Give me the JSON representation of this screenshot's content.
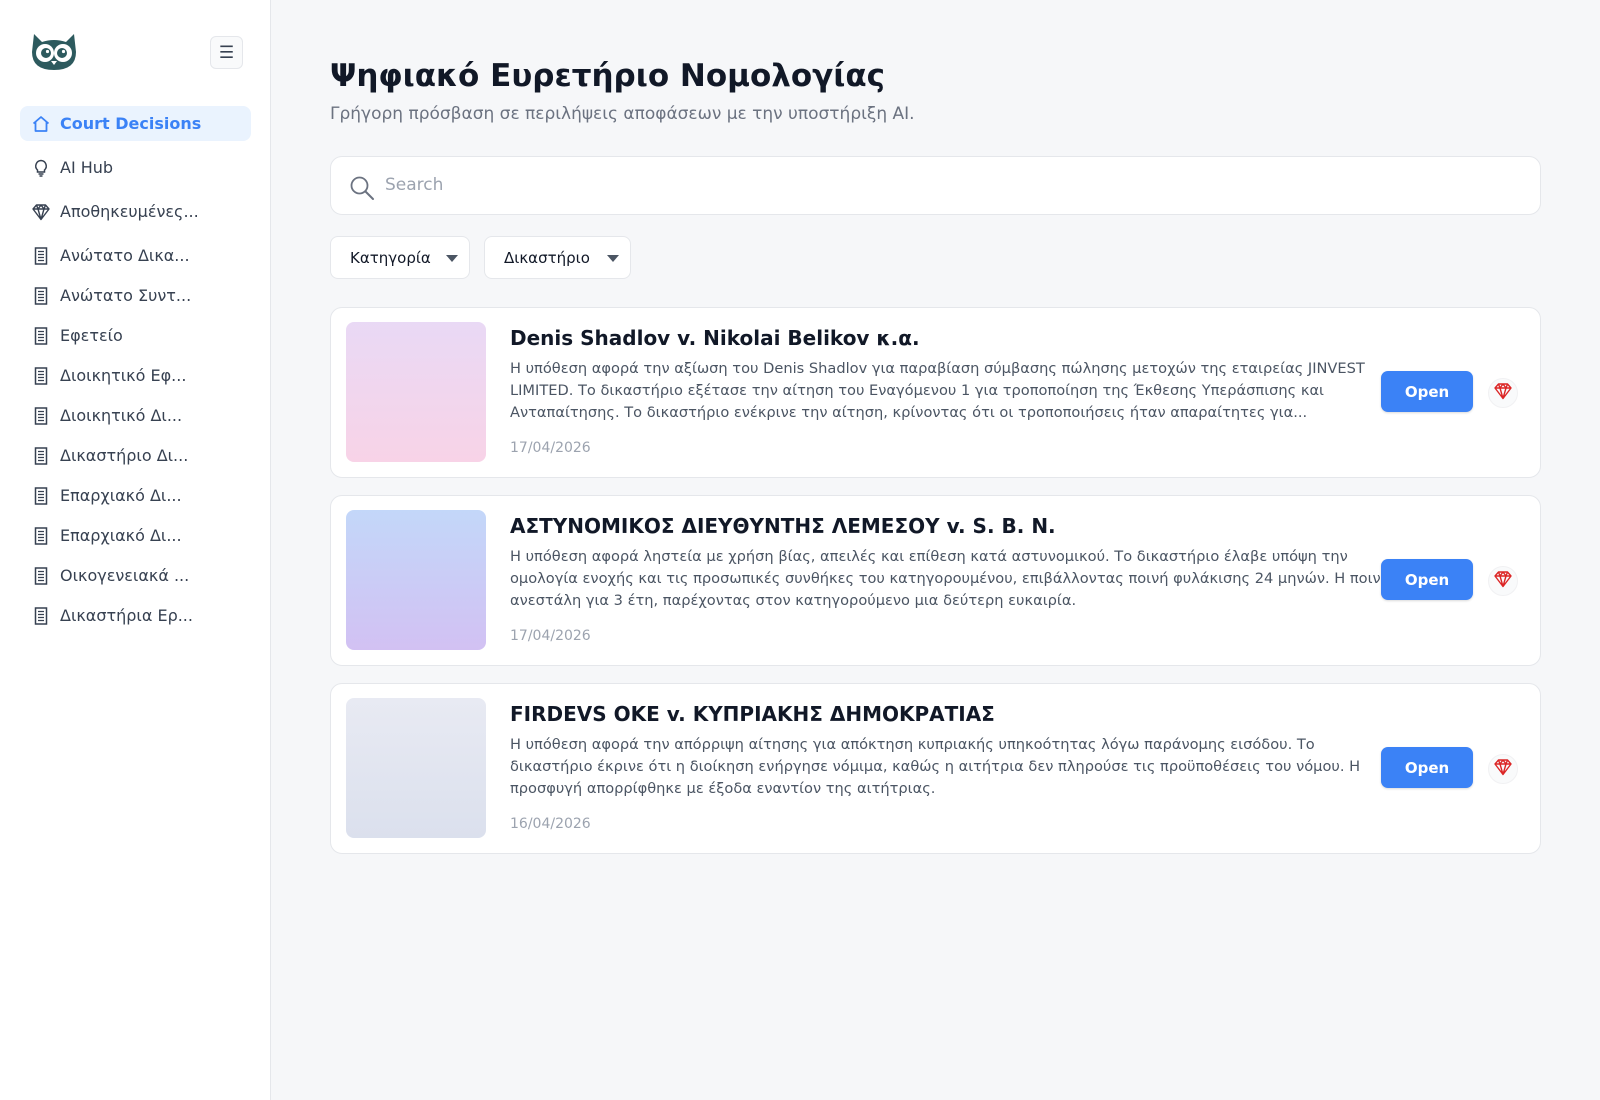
{
  "app": {
    "logo": "owl-logo",
    "menu_toggle": "☰"
  },
  "sidebar": {
    "items": [
      {
        "label": "Court Decisions",
        "icon": "home-icon",
        "active": true
      },
      {
        "label": "AI Hub",
        "icon": "lightbulb-icon"
      },
      {
        "label": "Αποθηκευμένες...",
        "icon": "diamond-icon"
      },
      {
        "label": "Ανώτατο Δικα...",
        "icon": "building-icon"
      },
      {
        "label": "Ανώτατο Συντ...",
        "icon": "building-icon"
      },
      {
        "label": "Εφετείο",
        "icon": "building-icon"
      },
      {
        "label": "Διοικητικό Εφ...",
        "icon": "building-icon"
      },
      {
        "label": "Διοικητικό Δι...",
        "icon": "building-icon"
      },
      {
        "label": "Δικαστήριο Δι...",
        "icon": "building-icon"
      },
      {
        "label": "Επαρχιακό Δι...",
        "icon": "building-icon"
      },
      {
        "label": "Επαρχιακό Δι...",
        "icon": "building-icon"
      },
      {
        "label": "Οικογενειακά ...",
        "icon": "building-icon"
      },
      {
        "label": "Δικαστήρια Ερ...",
        "icon": "building-icon"
      }
    ]
  },
  "main": {
    "title": "Ψηφιακό Ευρετήριο Νομολογίας",
    "subtitle": "Γρήγορη πρόσβαση σε περιλήψεις αποφάσεων με την υποστήριξη AI.",
    "search": {
      "placeholder": "Search",
      "value": ""
    },
    "filters": {
      "category": "Κατηγορία",
      "court": "Δικαστήριο"
    },
    "open_label": "Open",
    "cases": [
      {
        "title": "Denis Shadlov v. Nikolai Belikov κ.α.",
        "description": "Η υπόθεση αφορά την αξίωση του Denis Shadlov για παραβίαση σύμβασης πώλησης μετοχών της εταιρείας JINVEST LIMITED. Το δικαστήριο εξέτασε την αίτηση του Εναγόμενου 1 για τροποποίηση της Έκθεσης Υπεράσπισης και Ανταπαίτησης. Το δικαστήριο ενέκρινε την αίτηση, κρίνοντας ότι οι τροποποιήσεις ήταν απαραίτητες για...",
        "date": "17/04/2026",
        "thumb_colors": [
          "#e9d9f5",
          "#f8d3e7"
        ]
      },
      {
        "title": "ΑΣΤΥΝΟΜΙΚΟΣ ΔΙΕΥΘΥΝΤΗΣ ΛΕΜΕΣΟΥ v. S. B. N.",
        "description": "Η υπόθεση αφορά ληστεία με χρήση βίας, απειλές και επίθεση κατά αστυνομικού. Το δικαστήριο έλαβε υπόψη την ομολογία ενοχής και τις προσωπικές συνθήκες του κατηγορουμένου, επιβάλλοντας ποινή φυλάκισης 24 μηνών. Η ποινή ανεστάλη για 3 έτη, παρέχοντας στον κατηγορούμενο μια δεύτερη ευκαιρία.",
        "date": "17/04/2026",
        "thumb_colors": [
          "#c3d7f9",
          "#d2c1f3"
        ]
      },
      {
        "title": "FIRDEVS OKE v. ΚΥΠΡΙΑΚΗΣ ΔΗΜΟΚΡΑΤΙΑΣ",
        "description": "Η υπόθεση αφορά την απόρριψη αίτησης για απόκτηση κυπριακής υπηκοότητας λόγω παράνομης εισόδου. Το δικαστήριο έκρινε ότι η διοίκηση ενήργησε νόμιμα, καθώς η αιτήτρια δεν πληρούσε τις προϋποθέσεις του νόμου. Η προσφυγή απορρίφθηκε με έξοδα εναντίον της αιτήτριας.",
        "date": "16/04/2026",
        "thumb_colors": [
          "#e8eaf3",
          "#dbe0ed"
        ]
      }
    ]
  },
  "colors": {
    "accent": "#3b82f6",
    "active_bg": "#eaf3fe",
    "logo": "#2d5a5e",
    "save_icon": "#dc2626"
  }
}
